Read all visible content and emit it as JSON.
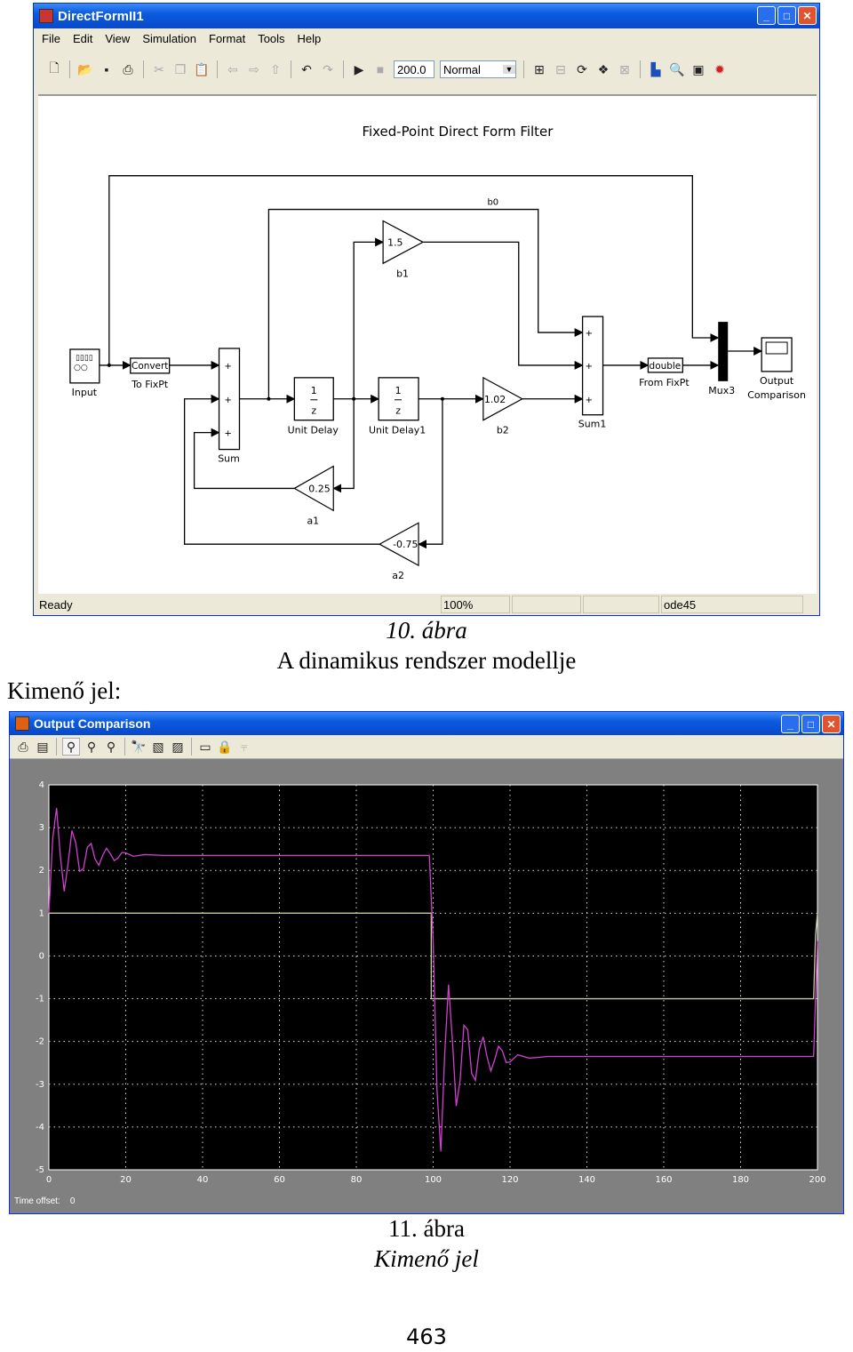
{
  "simulink": {
    "title": "DirectFormII1",
    "menu": [
      "File",
      "Edit",
      "View",
      "Simulation",
      "Format",
      "Tools",
      "Help"
    ],
    "stop_time": "200.0",
    "sim_mode": "Normal",
    "toolbar_icons": [
      "new-icon",
      "open-icon",
      "save-icon",
      "print-icon",
      "cut-icon",
      "copy-icon",
      "paste-icon",
      "back-icon",
      "forward-icon",
      "up-icon",
      "undo-icon",
      "redo-icon",
      "play-icon",
      "stop-icon",
      "build-icon",
      "update-icon",
      "refresh-icon",
      "library-icon",
      "debug-icon",
      "model-explorer-icon",
      "find-icon",
      "browser-icon",
      "debugger-icon"
    ],
    "diagram": {
      "title": "Fixed-Point Direct Form Filter",
      "input_label": "Input",
      "convert_text": "Convert",
      "convert_label": "To FixPt",
      "sum_label": "Sum",
      "plus": "+",
      "delay_num": "1",
      "delay_den": "z",
      "unit_delay_label": "Unit Delay",
      "unit_delay1_label": "Unit Delay1",
      "b0_label": "b0",
      "b1_value": "1.5",
      "b1_label": "b1",
      "b2_value": "1.02",
      "b2_label": "b2",
      "a1_value": "0.25",
      "a1_label": "a1",
      "a2_value": "-0.75",
      "a2_label": "a2",
      "sum1_label": "Sum1",
      "from_text": "double",
      "from_label": "From FixPt",
      "mux_label": "Mux3",
      "scope_label_1": "Output",
      "scope_label_2": "Comparison"
    },
    "status": {
      "left": "Ready",
      "zoom": "100%",
      "blank1": "",
      "blank2": "",
      "solver": "ode45"
    }
  },
  "caption1": {
    "number": "10. ábra",
    "text": "A dinamikus rendszer modellje"
  },
  "section_label": "Kimenő jel:",
  "scope": {
    "title": "Output Comparison",
    "toolbar_icons": [
      "print-icon",
      "parameters-icon",
      "zoom-icon",
      "zoom-x-icon",
      "zoom-y-icon",
      "autoscale-icon",
      "save-axes-icon",
      "restore-axes-icon",
      "floating-scope-icon",
      "lock-icon",
      "signal-selection-icon"
    ],
    "time_offset_label": "Time offset:",
    "time_offset_value": "0"
  },
  "chart_data": {
    "type": "line",
    "xlim": [
      0,
      200
    ],
    "ylim": [
      -5,
      4
    ],
    "xticks": [
      "0",
      "20",
      "40",
      "60",
      "80",
      "100",
      "120",
      "140",
      "160",
      "180",
      "200"
    ],
    "yticks": [
      "4",
      "3",
      "2",
      "1",
      "0",
      "-1",
      "-2",
      "-3",
      "-4",
      "-5"
    ],
    "grid": true,
    "background": "#000000",
    "series": [
      {
        "color": "#c8c8a0",
        "x": [
          0,
          99.5,
          99.5,
          199,
          199.5,
          200
        ],
        "y": [
          1,
          1,
          -1,
          -1,
          0.5,
          1
        ]
      },
      {
        "color": "#d040d0",
        "x": [
          0,
          1,
          2,
          3,
          4,
          5,
          6,
          7,
          8,
          9,
          10,
          11,
          12,
          13,
          14,
          15,
          16,
          17,
          18,
          19,
          20,
          22,
          25,
          30,
          99,
          100,
          101,
          102,
          103,
          104,
          105,
          106,
          107,
          108,
          109,
          110,
          111,
          112,
          113,
          114,
          115,
          116,
          117,
          118,
          119,
          120,
          122,
          125,
          130,
          199,
          200
        ],
        "y": [
          1,
          2.75,
          3.46,
          2.32,
          1.51,
          2.16,
          2.93,
          2.64,
          1.98,
          2.04,
          2.54,
          2.63,
          2.27,
          2.12,
          2.35,
          2.52,
          2.39,
          2.23,
          2.29,
          2.42,
          2.41,
          2.33,
          2.37,
          2.35,
          2.35,
          0.35,
          -3.15,
          -4.57,
          -2.3,
          -0.67,
          -1.96,
          -3.51,
          -2.92,
          -1.62,
          -1.73,
          -2.74,
          -2.91,
          -2.19,
          -1.89,
          -2.35,
          -2.69,
          -2.43,
          -2.11,
          -2.22,
          -2.49,
          -2.48,
          -2.31,
          -2.39,
          -2.35,
          -2.35,
          0.35
        ]
      }
    ]
  },
  "caption2": {
    "number": "11. ábra",
    "text": "Kimenő jel"
  },
  "page_number": "463"
}
